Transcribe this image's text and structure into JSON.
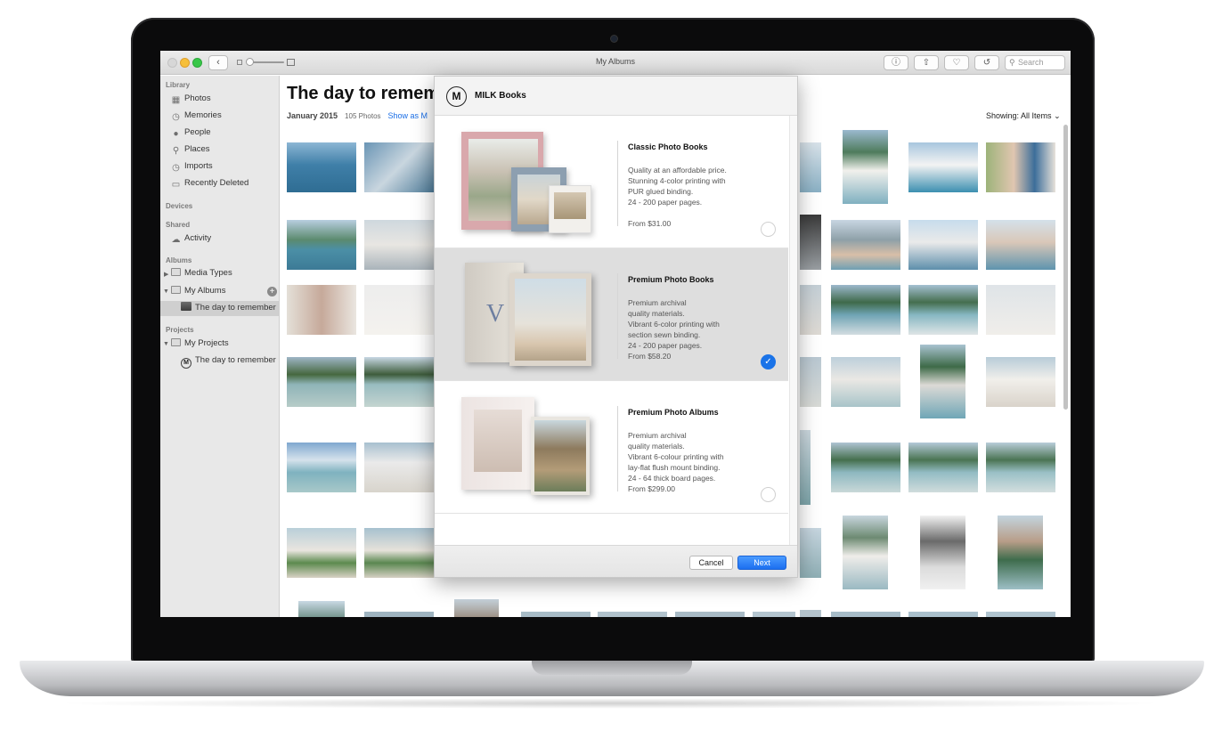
{
  "window": {
    "title": "My Albums",
    "search_placeholder": "Search",
    "toolbar_icons": [
      "info-icon",
      "share-icon",
      "heart-icon",
      "rotate-icon"
    ]
  },
  "sidebar": {
    "library_header": "Library",
    "library_items": [
      {
        "label": "Photos",
        "icon": "photos-icon"
      },
      {
        "label": "Memories",
        "icon": "memories-icon"
      },
      {
        "label": "People",
        "icon": "people-icon"
      },
      {
        "label": "Places",
        "icon": "places-icon"
      },
      {
        "label": "Imports",
        "icon": "imports-icon"
      },
      {
        "label": "Recently Deleted",
        "icon": "trash-icon"
      }
    ],
    "devices_header": "Devices",
    "shared_header": "Shared",
    "shared_items": [
      {
        "label": "Activity",
        "icon": "cloud-icon"
      }
    ],
    "albums_header": "Albums",
    "album_items": [
      {
        "label": "Media Types"
      },
      {
        "label": "My Albums"
      },
      {
        "label": "The day to remember"
      }
    ],
    "projects_header": "Projects",
    "project_items": [
      {
        "label": "My Projects"
      },
      {
        "label": "The day to remember"
      }
    ]
  },
  "main": {
    "title": "The day to rememb",
    "date": "January 2015",
    "count": "105 Photos",
    "show_link": "Show as M",
    "showing_label": "Showing: All Items"
  },
  "dialog": {
    "logo": "M",
    "title": "MILK Books",
    "products": [
      {
        "name": "Classic Photo Books",
        "desc": "Quality at an affordable price.\nStunning 4-color printing with\nPUR glued binding.\n24 - 200 paper pages.",
        "price": "From $31.00",
        "selected": false
      },
      {
        "name": "Premium Photo Books",
        "desc": "Premium archival\nquality materials.\nVibrant 6-color printing with\nsection sewn binding.\n24 - 200 paper pages.",
        "price": "From $58.20",
        "selected": true
      },
      {
        "name": "Premium Photo Albums",
        "desc": "Premium archival\nquality materials.\nVibrant 6-colour printing with\nlay-flat flush mount binding.\n24 - 64 thick board pages.",
        "price": "From $299.00",
        "selected": false
      }
    ],
    "cancel_label": "Cancel",
    "next_label": "Next"
  },
  "colors": {
    "accent": "#1a73e8",
    "sidebar_bg": "#e8e8e8",
    "selected_row": "#dedede"
  }
}
